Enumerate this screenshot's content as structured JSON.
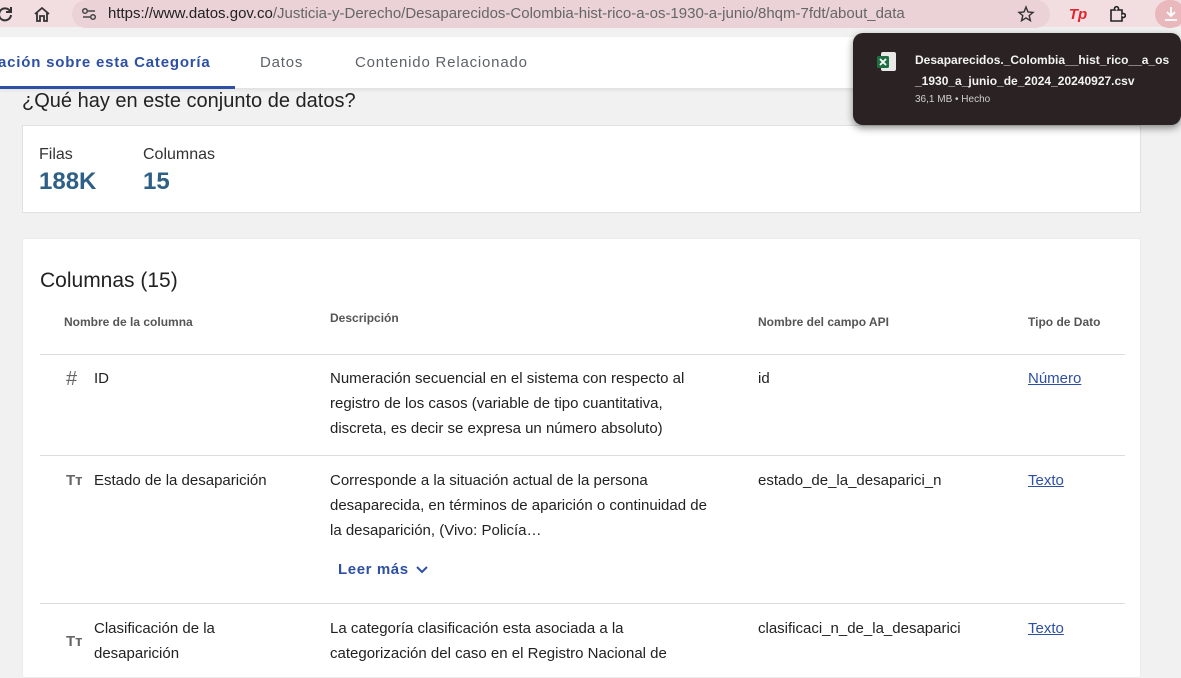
{
  "browser": {
    "url_host": "https://www.datos.gov.co",
    "url_path": "/Justicia-y-Derecho/Desaparecidos-Colombia-hist-rico-a-os-1930-a-junio/8hqm-7fdt/about_data",
    "extension_badge": "Tp"
  },
  "tabs": [
    {
      "label": "ación sobre esta Categoría",
      "active": true
    },
    {
      "label": "Datos",
      "active": false
    },
    {
      "label": "Contenido Relacionado",
      "active": false
    }
  ],
  "summary": {
    "title": "¿Qué hay en este conjunto de datos?",
    "rows_label": "Filas",
    "rows_value": "188K",
    "columns_label": "Columnas",
    "columns_value": "15"
  },
  "columns_section": {
    "title": "Columnas (15)",
    "headers": {
      "name": "Nombre de la columna",
      "description": "Descripción",
      "api": "Nombre del campo API",
      "type": "Tipo de Dato"
    },
    "rows": [
      {
        "icon": "#",
        "name": "ID",
        "description": "Numeración secuencial en el sistema con respecto al registro de los casos (variable de tipo cuantitativa, discreta, es decir se expresa un número absoluto)",
        "api": "id",
        "type": "Número"
      },
      {
        "icon": "Tт",
        "name": "Estado de la desaparición",
        "description": "Corresponde a la situación actual de la persona desaparecida, en términos de aparición o continuidad de la desaparición, (Vivo: Policía…",
        "read_more": "Leer más",
        "api": "estado_de_la_desaparici_n",
        "type": "Texto"
      },
      {
        "icon": "Tт",
        "name": "Clasificación de la desaparición",
        "description": "La categoría clasificación esta asociada a la categorización del caso en el Registro Nacional de",
        "api": "clasificaci_n_de_la_desaparici",
        "type": "Texto"
      }
    ]
  },
  "download": {
    "filename": "Desaparecidos._Colombia__hist_rico__a_os_1930_a_junio_de_2024_20240927.csv",
    "status": "36,1 MB • Hecho",
    "accent_color": "#1d6f42"
  }
}
